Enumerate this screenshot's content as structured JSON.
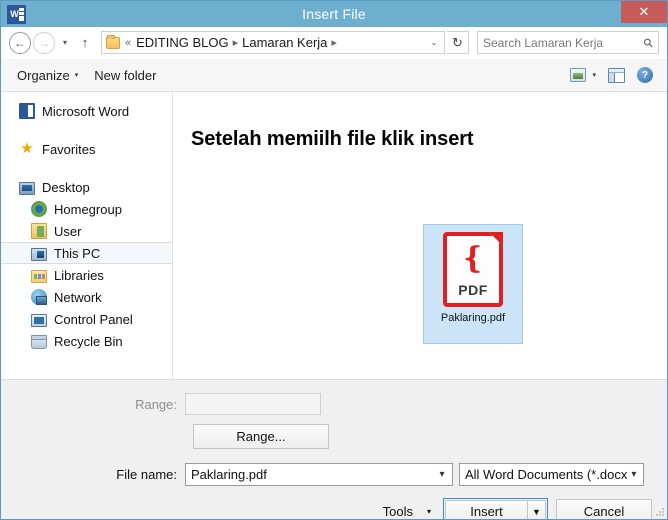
{
  "window": {
    "title": "Insert File",
    "app_icon": "word-icon",
    "close_label": "✕",
    "titlebar_color": "#6eafd0",
    "close_color": "#c75b5b"
  },
  "nav": {
    "back_icon": "←",
    "forward_icon": "→",
    "history_icon": "▾",
    "up_icon": "↑",
    "breadcrumb": {
      "folder_icon": "folder-icon",
      "overflow": "«",
      "items": [
        {
          "label": "EDITING BLOG"
        },
        {
          "label": "Lamaran Kerja"
        }
      ],
      "separator": "▸",
      "dropdown_icon": "⌄"
    },
    "refresh_icon": "↻",
    "search": {
      "placeholder": "Search Lamaran Kerja",
      "value": "",
      "icon": "search-icon"
    }
  },
  "commandbar": {
    "organize_label": "Organize",
    "organize_caret": "▾",
    "new_folder_label": "New folder",
    "view_icon": "view-icon",
    "view_caret": "▾",
    "preview_pane_icon": "preview-pane-icon",
    "help_icon": "?"
  },
  "sidebar": {
    "items": [
      {
        "label": "Microsoft Word",
        "icon": "word-icon",
        "indent": false,
        "selected": false
      },
      {
        "label": "Favorites",
        "icon": "star-icon",
        "indent": false,
        "selected": false
      },
      {
        "label": "Desktop",
        "icon": "desktop-icon",
        "indent": false,
        "selected": false
      },
      {
        "label": "Homegroup",
        "icon": "homegroup-icon",
        "indent": true,
        "selected": false
      },
      {
        "label": "User",
        "icon": "user-folder-icon",
        "indent": true,
        "selected": false
      },
      {
        "label": "This PC",
        "icon": "this-pc-icon",
        "indent": true,
        "selected": true
      },
      {
        "label": "Libraries",
        "icon": "libraries-icon",
        "indent": true,
        "selected": false
      },
      {
        "label": "Network",
        "icon": "network-icon",
        "indent": true,
        "selected": false
      },
      {
        "label": "Control Panel",
        "icon": "control-panel-icon",
        "indent": true,
        "selected": false
      },
      {
        "label": "Recycle Bin",
        "icon": "recycle-bin-icon",
        "indent": true,
        "selected": false
      }
    ]
  },
  "filepane": {
    "annotation": "Setelah memiilh file klik insert",
    "selection_color": "#cce4f7",
    "files": [
      {
        "name": "Paklaring.pdf",
        "type": "pdf",
        "badge": "PDF",
        "selected": true,
        "icon_color": "#e02020"
      }
    ]
  },
  "bottom": {
    "range_label": "Range:",
    "range_value": "",
    "range_disabled": true,
    "range_button_label": "Range...",
    "file_name_label": "File name:",
    "file_name_value": "Paklaring.pdf",
    "file_type_value": "All Word Documents (*.docx;*.d",
    "tools_label": "Tools",
    "tools_caret": "▾",
    "insert_label": "Insert",
    "insert_caret": "▼",
    "cancel_label": "Cancel"
  }
}
